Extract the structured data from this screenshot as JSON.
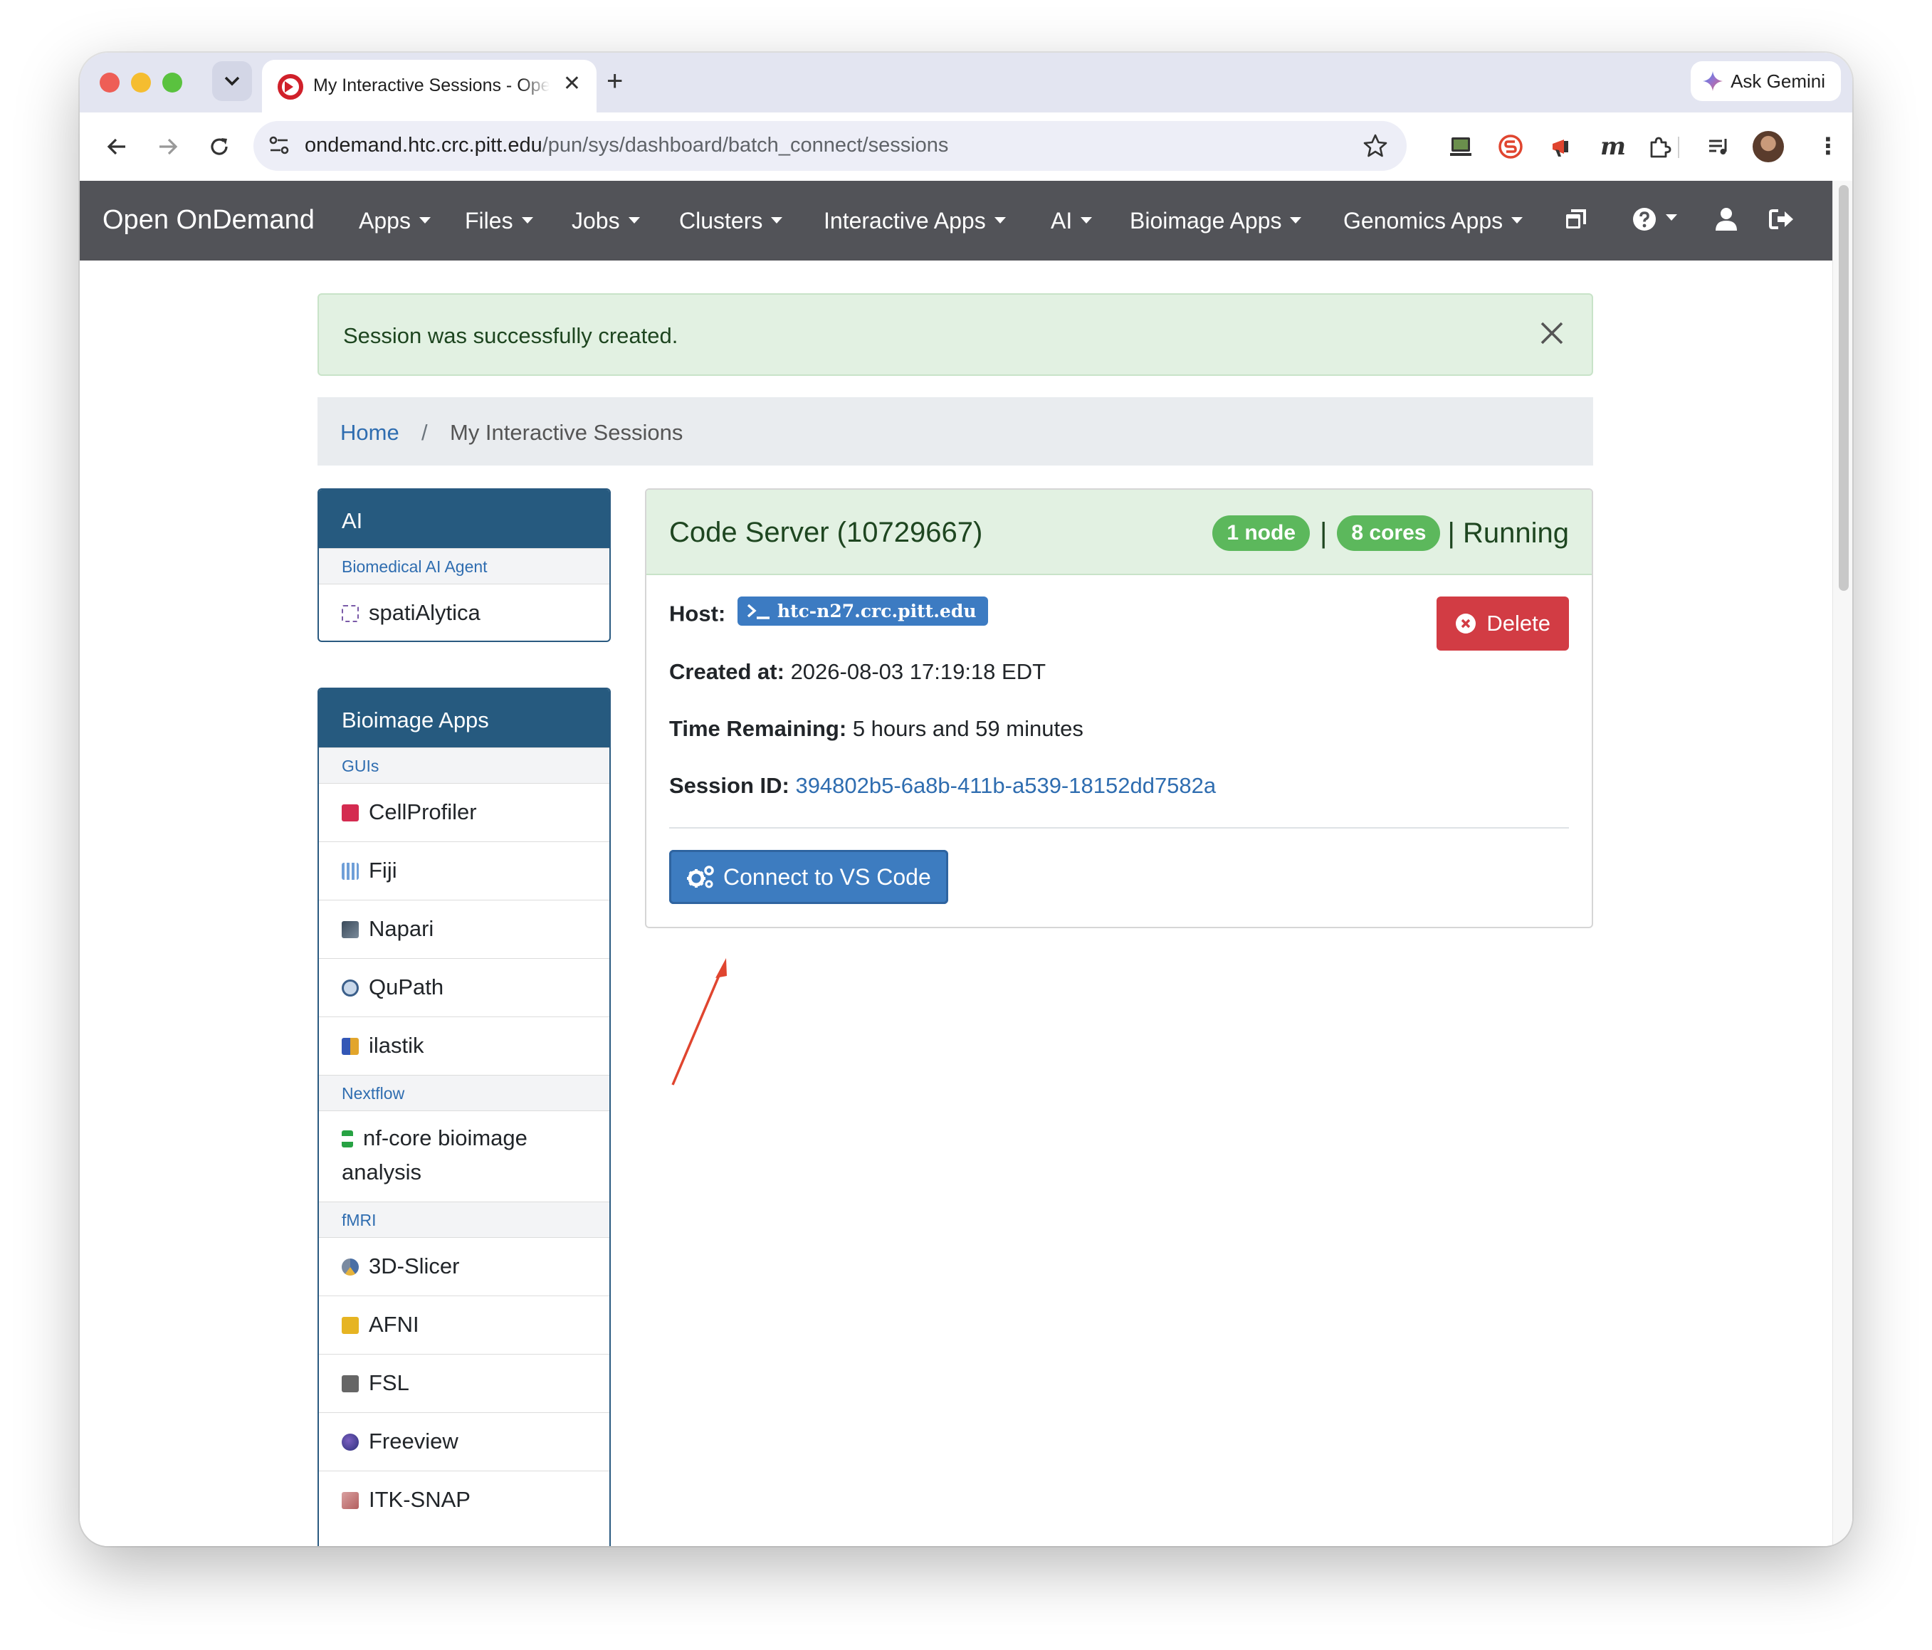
{
  "browser": {
    "tab_title": "My Interactive Sessions - Open OnDemand",
    "new_tab": "+",
    "tab_close": "✕",
    "ask_gemini": "Ask Gemini",
    "url_host": "ondemand.htc.crc.pitt.edu",
    "url_path": "/pun/sys/dashboard/batch_connect/sessions",
    "kebab": "⋮"
  },
  "navbar": {
    "brand": "Open OnDemand",
    "items": [
      "Apps",
      "Files",
      "Jobs",
      "Clusters",
      "Interactive Apps",
      "AI",
      "Bioimage Apps",
      "Genomics Apps"
    ],
    "background": "#525358"
  },
  "alert": {
    "message": "Session was successfully created."
  },
  "breadcrumb": {
    "home": "Home",
    "separator": "/",
    "current": "My Interactive Sessions"
  },
  "sidebar": {
    "ai_panel": {
      "title": "AI",
      "category": "Biomedical AI Agent",
      "items": [
        "spatiAlytica"
      ]
    },
    "bioimage_panel": {
      "title": "Bioimage Apps",
      "categories": {
        "guis": "GUIs",
        "nextflow": "Nextflow",
        "fmri": "fMRI"
      },
      "gui_items": [
        "CellProfiler",
        "Fiji",
        "Napari",
        "QuPath",
        "ilastik"
      ],
      "nextflow_items": [
        "nf-core bioimage analysis"
      ],
      "fmri_items": [
        "3D-Slicer",
        "AFNI",
        "FSL",
        "Freeview",
        "ITK-SNAP"
      ]
    }
  },
  "session": {
    "title": "Code Server (10729667)",
    "nodes": "1 node",
    "cores": "8 cores",
    "separator": "|",
    "status": "| Running",
    "host_label": "Host:",
    "host": "htc-n27.crc.pitt.edu",
    "created_label": "Created at:",
    "created": "2026-08-03 17:19:18 EDT",
    "time_label": "Time Remaining:",
    "time_remaining": "5 hours and 59 minutes",
    "id_label": "Session ID:",
    "session_id": "394802b5-6a8b-411b-a539-18152dd7582a",
    "delete_label": "Delete",
    "connect_label": "Connect to VS Code",
    "header_color": "#e2f1e2",
    "badge_color": "#5cb85c",
    "delete_color": "#d23c44",
    "connect_color": "#3d7cc0"
  }
}
